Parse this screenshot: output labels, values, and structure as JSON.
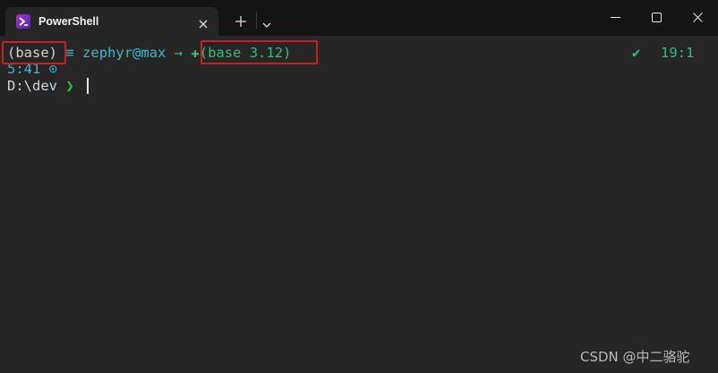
{
  "tab": {
    "title": "PowerShell",
    "icon": "powershell-icon"
  },
  "titlebar": {
    "new_tab_icon": "plus-icon",
    "dropdown_icon": "chevron-down-icon",
    "minimize_icon": "minimize-icon",
    "maximize_icon": "maximize-icon",
    "close_icon": "close-icon"
  },
  "prompt": {
    "env": "(base)",
    "user_icon": "menu-lines-icon",
    "user": "zephyr@max",
    "arrow": "→",
    "python_icon": "python-icon",
    "python_env": "(base 3.12)",
    "time": "5:41",
    "clock_icon": "clock-icon",
    "path": "D:\\dev",
    "chevron": "❯",
    "status_check": "✔",
    "line_info": "19:1"
  },
  "colors": {
    "background": "#262626",
    "titlebar": "#141414",
    "highlight_box": "#c8201f",
    "user": "#3fb7c9",
    "green": "#2fc07a"
  },
  "watermark": "CSDN @中二骆驼"
}
